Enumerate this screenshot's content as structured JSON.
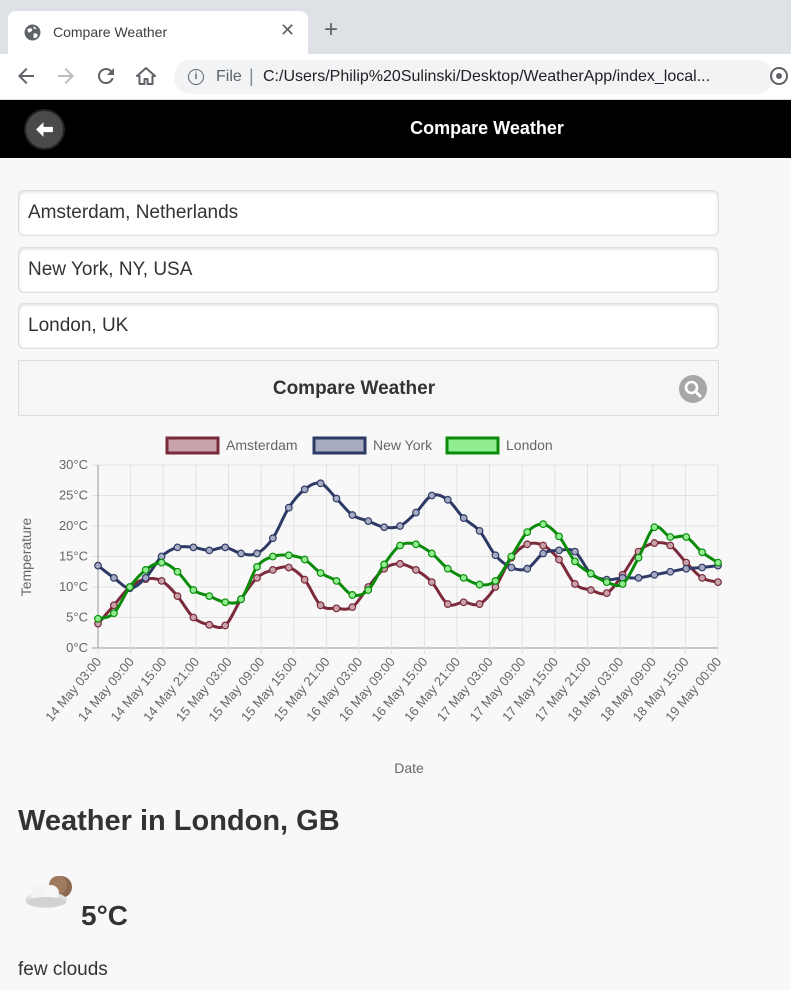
{
  "browser": {
    "tab_title": "Compare Weather",
    "new_tab": "+",
    "scheme": "File",
    "separator": "|",
    "url": "C:/Users/Philip%20Sulinski/Desktop/WeatherApp/index_local...",
    "info_glyph": "i"
  },
  "header": {
    "title": "Compare Weather"
  },
  "inputs": {
    "city1": "Amsterdam, Netherlands",
    "city2": "New York, NY, USA",
    "city3": "London, UK"
  },
  "compare_button": {
    "label": "Compare Weather"
  },
  "chart_data": {
    "type": "line",
    "xlabel": "Date",
    "ylabel": "Temperature",
    "ylim": [
      0,
      30
    ],
    "y_ticks": [
      "0°C",
      "5°C",
      "10°C",
      "15°C",
      "20°C",
      "25°C",
      "30°C"
    ],
    "x_tick_labels": [
      "14 May 03:00",
      "14 May 09:00",
      "14 May 15:00",
      "14 May 21:00",
      "15 May 03:00",
      "15 May 09:00",
      "15 May 15:00",
      "15 May 21:00",
      "16 May 03:00",
      "16 May 09:00",
      "16 May 15:00",
      "16 May 21:00",
      "17 May 03:00",
      "17 May 09:00",
      "17 May 15:00",
      "17 May 21:00",
      "18 May 03:00",
      "18 May 09:00",
      "18 May 15:00",
      "19 May 00:00"
    ],
    "grid": true,
    "legend_position": "top",
    "series": [
      {
        "name": "Amsterdam",
        "color": "#7a2a3a",
        "fill": "#c9a3aa",
        "values": [
          4,
          7,
          10,
          11.3,
          11,
          8.5,
          5,
          3.8,
          3.7,
          8,
          11.5,
          12.8,
          13.2,
          11.2,
          7,
          6.5,
          6.7,
          10,
          13,
          13.8,
          12.8,
          10.8,
          7.2,
          7.5,
          7.2,
          10,
          14.8,
          17,
          16.8,
          14.5,
          10.5,
          9.5,
          9,
          12,
          15.8,
          17.2,
          16.8,
          14,
          11.5,
          10.8
        ]
      },
      {
        "name": "New York",
        "color": "#2e3a66",
        "fill": "#a6abc2",
        "values": [
          13.5,
          11.5,
          9.8,
          11.5,
          15,
          16.5,
          16.5,
          16,
          16.5,
          15.5,
          15.5,
          18,
          23,
          26,
          27,
          24.5,
          21.8,
          20.8,
          19.8,
          20,
          22.2,
          25,
          24.3,
          21.3,
          19.2,
          15.2,
          13.2,
          13,
          15.5,
          16,
          15.8,
          12.2,
          11.2,
          11.5,
          11.5,
          12,
          12.5,
          13,
          13.2,
          13.5
        ]
      },
      {
        "name": "London",
        "color": "#0a8c0a",
        "fill": "#90ee90",
        "values": [
          4.8,
          5.7,
          10,
          12.8,
          14,
          12.5,
          9.5,
          8.5,
          7.5,
          8,
          13.3,
          15,
          15.2,
          14.5,
          12.3,
          11,
          8.7,
          9.5,
          13.7,
          16.8,
          17,
          15.5,
          13,
          11.5,
          10.4,
          11,
          15,
          19,
          20.3,
          18.3,
          14.2,
          12.2,
          10.8,
          10.5,
          14.8,
          19.8,
          18.2,
          18.2,
          15.7,
          14
        ]
      }
    ]
  },
  "weather": {
    "title": "Weather in London, GB",
    "icon": "few-clouds-icon",
    "temperature": "5°C",
    "description": "few clouds"
  }
}
